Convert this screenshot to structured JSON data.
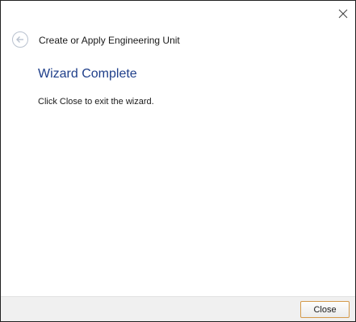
{
  "window": {
    "title": "Create or Apply Engineering Unit",
    "close_icon": "close-x-icon",
    "back_icon": "back-arrow-icon"
  },
  "content": {
    "heading": "Wizard Complete",
    "instruction": "Click Close to exit the wizard."
  },
  "footer": {
    "close_label": "Close"
  },
  "colors": {
    "heading": "#1f3f8a",
    "footer_bg": "#f0f0f0",
    "button_border": "#d49a4b"
  }
}
